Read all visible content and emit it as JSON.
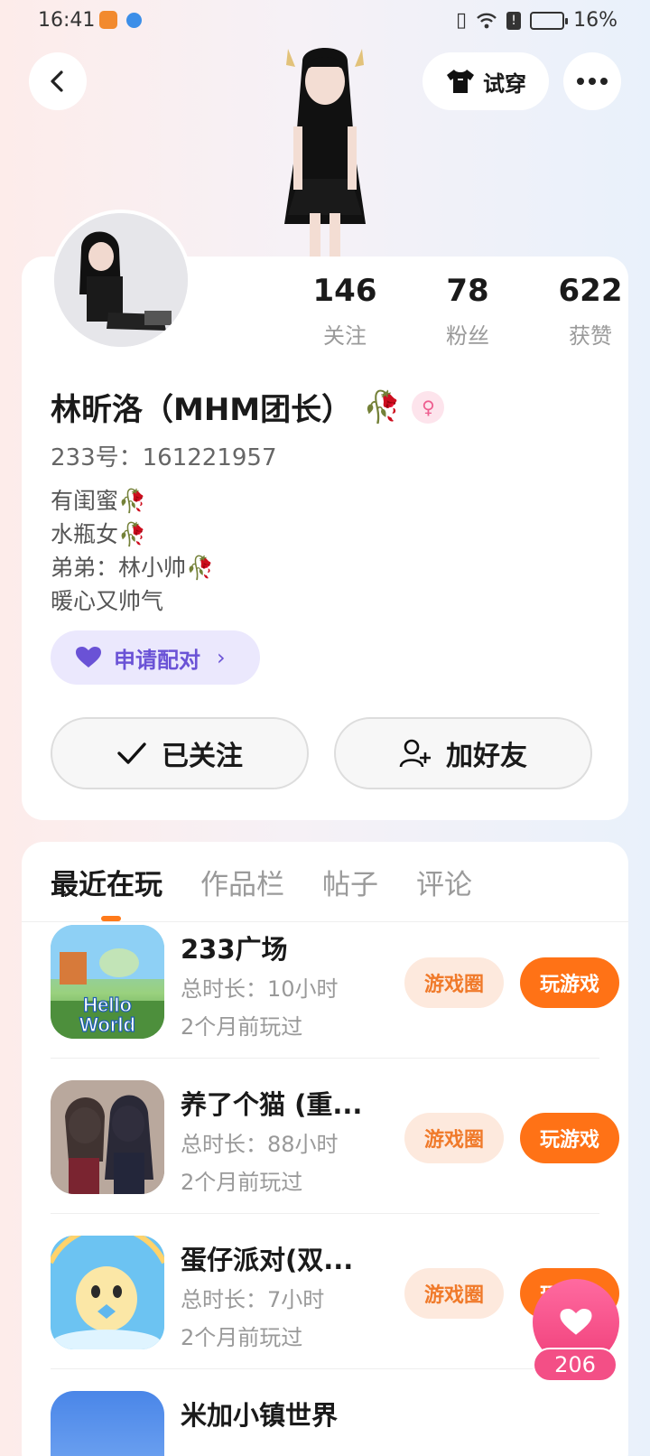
{
  "status_bar": {
    "time": "16:41",
    "battery": "16%"
  },
  "header": {
    "try_on_label": "试穿"
  },
  "profile": {
    "stats": [
      {
        "value": "146",
        "label": "关注"
      },
      {
        "value": "78",
        "label": "粉丝"
      },
      {
        "value": "622",
        "label": "获赞"
      }
    ],
    "name": "林昕洛（MHM团长）",
    "name_emoji": "🥀",
    "gender_symbol": "♀",
    "uid": "233号：161221957",
    "bio_lines": [
      "有闺蜜🥀",
      "水瓶女🥀",
      "弟弟：林小帅🥀",
      "暖心又帅气"
    ],
    "pair_label": "申请配对",
    "followed_label": "已关注",
    "add_friend_label": "加好友"
  },
  "tabs": [
    "最近在玩",
    "作品栏",
    "帖子",
    "评论"
  ],
  "games": [
    {
      "title": "233广场",
      "duration": "总时长：10小时",
      "last_played": "2个月前玩过",
      "circle_label": "游戏圈",
      "play_label": "玩游戏",
      "icon_text": "Hello World"
    },
    {
      "title": "养了个猫 (重...",
      "duration": "总时长：88小时",
      "last_played": "2个月前玩过",
      "circle_label": "游戏圈",
      "play_label": "玩游戏"
    },
    {
      "title": "蛋仔派对(双...",
      "duration": "总时长：7小时",
      "last_played": "2个月前玩过",
      "circle_label": "游戏圈",
      "play_label": "玩游戏"
    },
    {
      "title": "米加小镇世界"
    }
  ],
  "like": {
    "count": "206"
  },
  "colors": {
    "accent_orange": "#ff7216",
    "pair_purple": "#6a52d6",
    "like_pink": "#f0407a"
  }
}
